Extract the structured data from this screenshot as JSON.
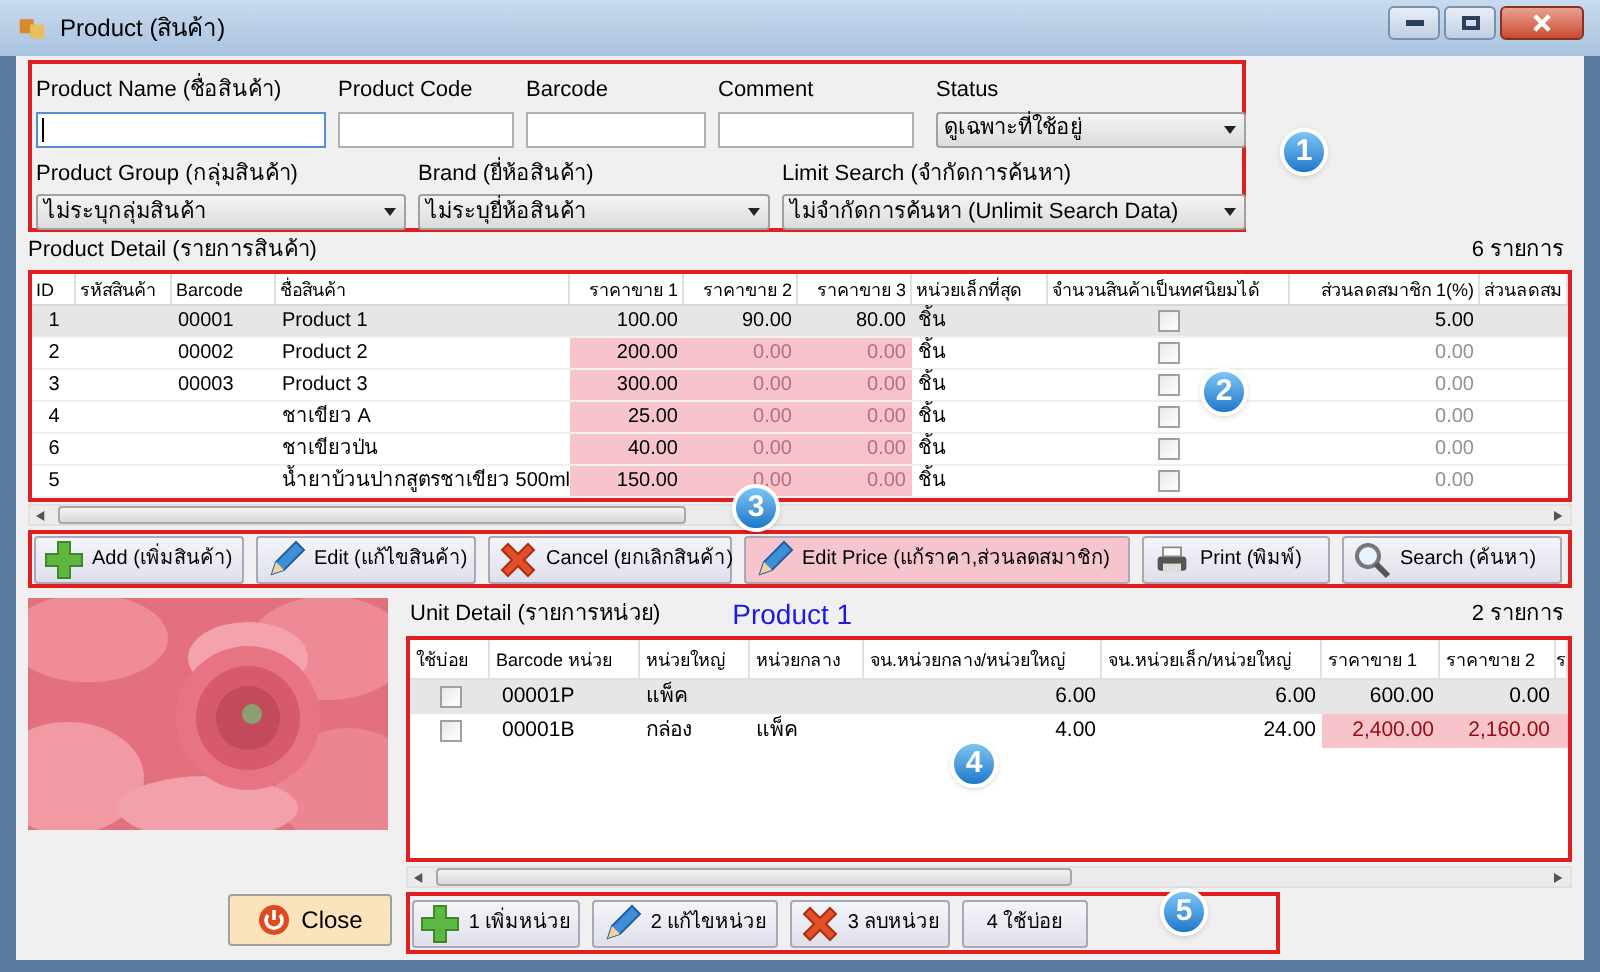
{
  "window": {
    "title": "Product (สินค้า)"
  },
  "filters": {
    "fields": [
      {
        "label": "Product Name (ชื่อสินค้า)",
        "focused": true
      },
      {
        "label": "Product Code",
        "focused": false
      },
      {
        "label": "Barcode",
        "focused": false
      },
      {
        "label": "Comment",
        "focused": false
      }
    ],
    "status": {
      "label": "Status",
      "value": "ดูเฉพาะที่ใช้อยู่"
    },
    "dropdowns": [
      {
        "label": "Product Group (กลุ่มสินค้า)",
        "value": "ไม่ระบุกลุ่มสินค้า"
      },
      {
        "label": "Brand (ยี่ห้อสินค้า)",
        "value": "ไม่ระบุยี่ห้อสินค้า"
      },
      {
        "label": "Limit Search (จำกัดการค้นหา)",
        "value": "ไม่จำกัดการค้นหา (Unlimit Search Data)"
      }
    ]
  },
  "product_detail": {
    "title": "Product Detail (รายการสินค้า)",
    "count": "6 รายการ",
    "columns": [
      "ID",
      "รหัสสินค้า",
      "Barcode",
      "ชื่อสินค้า",
      "ราคาขาย 1",
      "ราคาขาย 2",
      "ราคาขาย 3",
      "หน่วยเล็กที่สุด",
      "จำนวนสินค้าเป็นทศนิยมได้",
      "ส่วนลดสมาชิก 1(%)",
      "ส่วนลดสม"
    ],
    "rows": [
      {
        "selected": true,
        "id": "1",
        "barcode": "00001",
        "name": "Product 1",
        "prices": [
          {
            "text": "100.00",
            "highlighted": false,
            "dimmed": false
          },
          {
            "text": "90.00",
            "highlighted": false,
            "dimmed": false
          },
          {
            "text": "80.00",
            "highlighted": false,
            "dimmed": false
          }
        ],
        "unit": "ชิ้น",
        "decimal": false,
        "discount": {
          "text": "5.00",
          "dimmed": false
        }
      },
      {
        "selected": false,
        "id": "2",
        "barcode": "00002",
        "name": "Product 2",
        "prices": [
          {
            "text": "200.00",
            "highlighted": true,
            "dimmed": false
          },
          {
            "text": "0.00",
            "highlighted": true,
            "dimmed": true
          },
          {
            "text": "0.00",
            "highlighted": true,
            "dimmed": true
          }
        ],
        "unit": "ชิ้น",
        "decimal": false,
        "discount": {
          "text": "0.00",
          "dimmed": true
        }
      },
      {
        "selected": false,
        "id": "3",
        "barcode": "00003",
        "name": "Product 3",
        "prices": [
          {
            "text": "300.00",
            "highlighted": true,
            "dimmed": false
          },
          {
            "text": "0.00",
            "highlighted": true,
            "dimmed": true
          },
          {
            "text": "0.00",
            "highlighted": true,
            "dimmed": true
          }
        ],
        "unit": "ชิ้น",
        "decimal": false,
        "discount": {
          "text": "0.00",
          "dimmed": true
        }
      },
      {
        "selected": false,
        "id": "4",
        "name": "ชาเขียว A",
        "prices": [
          {
            "text": "25.00",
            "highlighted": true,
            "dimmed": false
          },
          {
            "text": "0.00",
            "highlighted": true,
            "dimmed": true
          },
          {
            "text": "0.00",
            "highlighted": true,
            "dimmed": true
          }
        ],
        "unit": "ชิ้น",
        "decimal": false,
        "discount": {
          "text": "0.00",
          "dimmed": true
        }
      },
      {
        "selected": false,
        "id": "6",
        "name": "ชาเขียวป่น",
        "prices": [
          {
            "text": "40.00",
            "highlighted": true,
            "dimmed": false
          },
          {
            "text": "0.00",
            "highlighted": true,
            "dimmed": true
          },
          {
            "text": "0.00",
            "highlighted": true,
            "dimmed": true
          }
        ],
        "unit": "ชิ้น",
        "decimal": false,
        "discount": {
          "text": "0.00",
          "dimmed": true
        }
      },
      {
        "selected": false,
        "id": "5",
        "name": "น้ำยาบ้วนปากสูตรชาเขียว  500ml",
        "prices": [
          {
            "text": "150.00",
            "highlighted": true,
            "dimmed": false
          },
          {
            "text": "0.00",
            "highlighted": true,
            "dimmed": true
          },
          {
            "text": "0.00",
            "highlighted": true,
            "dimmed": true
          }
        ],
        "unit": "ชิ้น",
        "decimal": false,
        "discount": {
          "text": "0.00",
          "dimmed": true
        }
      }
    ]
  },
  "toolbar": [
    {
      "kind": "add",
      "label": "Add (เพิ่มสินค้า)",
      "highlighted": false
    },
    {
      "kind": "edit",
      "label": "Edit (แก้ไขสินค้า)",
      "highlighted": false
    },
    {
      "kind": "cancel",
      "label": "Cancel (ยกเลิกสินค้า)",
      "highlighted": false
    },
    {
      "kind": "edit",
      "label": "Edit Price (แก้ราคา,ส่วนลดสมาชิก)",
      "highlighted": true
    },
    {
      "kind": "print",
      "label": "Print (พิมพ์)",
      "highlighted": false
    },
    {
      "kind": "search",
      "label": "Search (ค้นหา)",
      "highlighted": false
    }
  ],
  "unit_detail": {
    "title": "Unit Detail (รายการหน่วย)",
    "product": "Product 1",
    "count": "2 รายการ",
    "columns": [
      "ใช้บ่อย",
      "Barcode หน่วย",
      "หน่วยใหญ่",
      "หน่วยกลาง",
      "จน.หน่วยกลาง/หน่วยใหญ่",
      "จน.หน่วยเล็ก/หน่วยใหญ่",
      "ราคาขาย 1",
      "ราคาขาย 2",
      "ร"
    ],
    "rows": [
      {
        "selected": true,
        "frequent": false,
        "barcode": "00001P",
        "large_unit": "แพ็ค",
        "mid_per_large": "6.00",
        "small_per_large": "6.00",
        "prices": [
          {
            "text": "600.00",
            "highlighted": false
          },
          {
            "text": "0.00",
            "highlighted": false
          }
        ]
      },
      {
        "selected": false,
        "frequent": false,
        "barcode": "00001B",
        "large_unit": "กล่อง",
        "middle_unit": "แพ็ค",
        "mid_per_large": "4.00",
        "small_per_large": "24.00",
        "prices": [
          {
            "text": "2,400.00",
            "highlighted": true
          },
          {
            "text": "2,160.00",
            "highlighted": true
          }
        ]
      }
    ]
  },
  "unit_buttons": [
    {
      "kind": "add",
      "label": "1 เพิ่มหน่วย"
    },
    {
      "kind": "edit",
      "label": "2 แก้ไขหน่วย"
    },
    {
      "kind": "cancel",
      "label": "3 ลบหน่วย"
    },
    {
      "kind": "plain",
      "label": "4 ใช้บ่อย"
    }
  ],
  "close_button": {
    "label": "Close"
  },
  "product_image": {
    "kind": "picture"
  },
  "callouts": [
    "1",
    "2",
    "3",
    "4",
    "5"
  ]
}
